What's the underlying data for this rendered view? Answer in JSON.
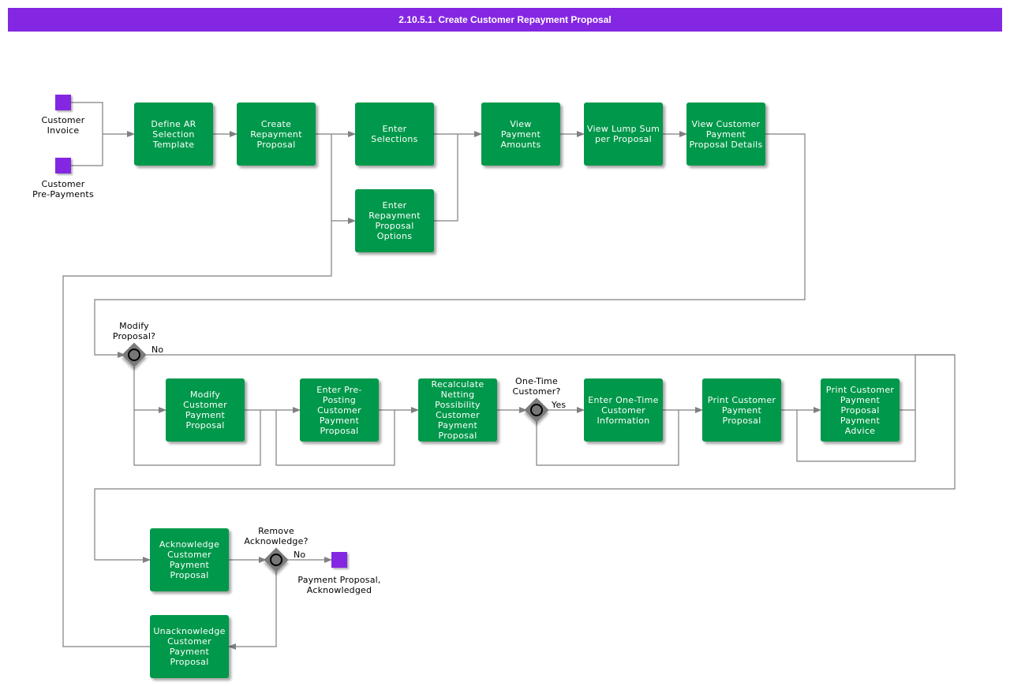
{
  "title": "2.10.5.1. Create Customer Repayment Proposal",
  "colors": {
    "title_bar": "#8427e2",
    "task": "#00984a",
    "event": "#8427e2",
    "gateway": "#7a7a7a",
    "connector": "#808080"
  },
  "events": {
    "customer_invoice": "Customer\nInvoice",
    "customer_prepayments": "Customer\nPre-Payments",
    "end_acknowledged": "Payment Proposal,\nAcknowledged"
  },
  "tasks": {
    "define_ar": "Define AR\nSelection\nTemplate",
    "create_repayment": "Create\nRepayment\nProposal",
    "enter_selections": "Enter\nSelections",
    "enter_options": "Enter\nRepayment\nProposal\nOptions",
    "view_payment_amounts": "View\nPayment\nAmounts",
    "view_lump_sum": "View Lump Sum\nper Proposal",
    "view_details": "View Customer\nPayment\nProposal Details",
    "modify_proposal": "Modify\nCustomer\nPayment\nProposal",
    "enter_preposting": "Enter Pre-\nPosting\nCustomer\nPayment\nProposal",
    "recalculate_netting": "Recalculate\nNetting\nPossibility\nCustomer\nPayment\nProposal",
    "enter_onetime": "Enter One-Time\nCustomer\nInformation",
    "print_proposal": "Print Customer\nPayment\nProposal",
    "print_advice": "Print Customer\nPayment\nProposal\nPayment\nAdvice",
    "acknowledge": "Acknowledge\nCustomer\nPayment\nProposal",
    "unacknowledge": "Unacknowledge\nCustomer\nPayment\nProposal"
  },
  "gateways": {
    "modify": {
      "question": "Modify\nProposal?",
      "branch": "No"
    },
    "onetime": {
      "question": "One-Time\nCustomer?",
      "branch": "Yes"
    },
    "remove_ack": {
      "question": "Remove\nAcknowledge?",
      "branch": "No"
    }
  }
}
